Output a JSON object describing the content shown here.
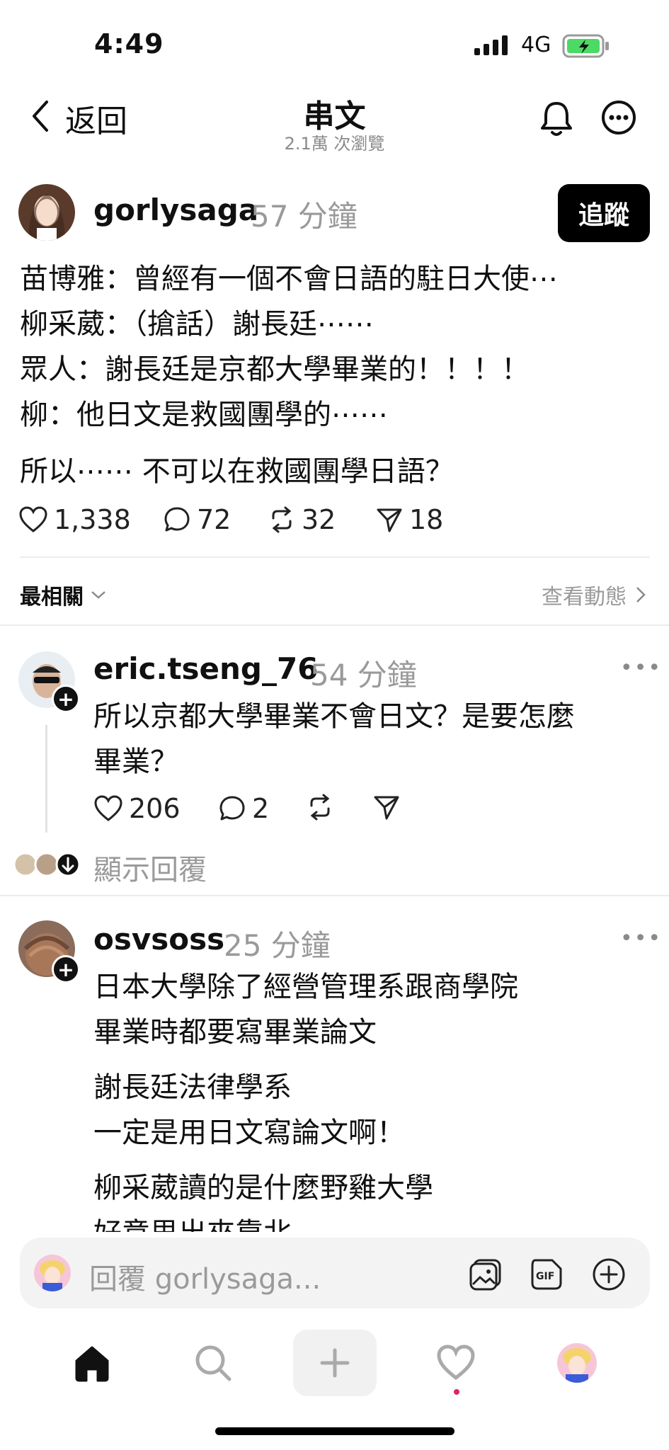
{
  "status": {
    "time": "4:49",
    "network": "4G"
  },
  "header": {
    "back_label": "返回",
    "title": "串文",
    "views": "2.1萬 次瀏覽"
  },
  "post": {
    "username": "gorlysaga",
    "time": "57 分鐘",
    "follow_label": "追蹤",
    "lines": [
      "苗博雅：曾經有一個不會日語的駐日大使⋯",
      "柳采葳：（搶話）謝長廷⋯⋯",
      "眾人：謝長廷是京都大學畢業的！！！！",
      "柳：他日文是救國團學的⋯⋯",
      "所以⋯⋯ 不可以在救國團學日語？"
    ],
    "likes": "1,338",
    "comments": "72",
    "reposts": "32",
    "shares": "18"
  },
  "filter": {
    "sort_label": "最相關",
    "view_activity": "查看動態"
  },
  "comments": [
    {
      "username": "eric.tseng_76",
      "time": "54 分鐘",
      "lines": [
        "所以京都大學畢業不會日文？是要怎麼",
        "畢業？"
      ],
      "likes": "206",
      "replies": "2",
      "show_replies": "顯示回覆"
    },
    {
      "username": "osvsoss",
      "time": "25 分鐘",
      "lines": [
        "日本大學除了經營管理系跟商學院",
        "畢業時都要寫畢業論文",
        "謝長廷法律學系",
        "一定是用日文寫論文啊！",
        "柳采葳讀的是什麼野雞大學",
        "好意思出來靠北"
      ]
    }
  ],
  "reply_bar": {
    "placeholder": "回覆 gorlysaga..."
  },
  "colors": {
    "accent_black": "#000000",
    "notification_dot": "#e0245e",
    "battery_green": "#4cd964"
  }
}
